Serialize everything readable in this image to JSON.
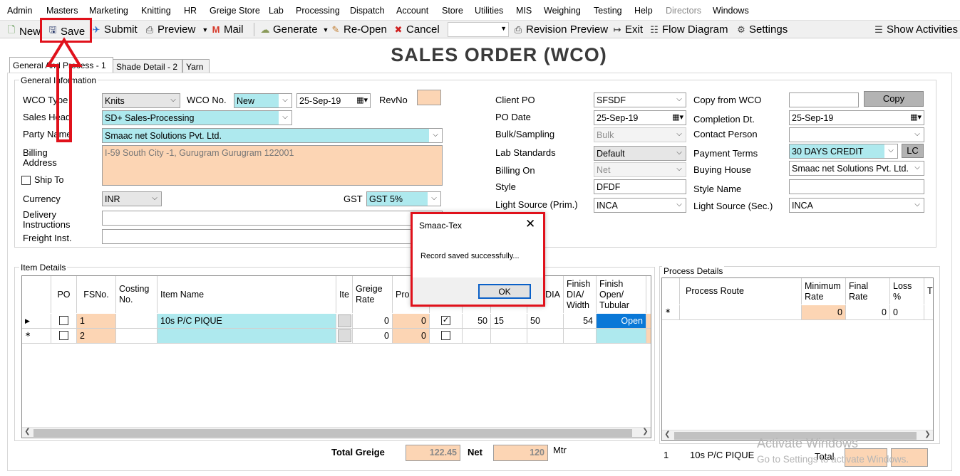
{
  "menu": [
    "Admin",
    "Masters",
    "Marketing",
    "Knitting",
    "HR",
    "Greige Store",
    "Lab",
    "Processing",
    "Dispatch",
    "Account",
    "Store",
    "Utilities",
    "MIS",
    "Weighing",
    "Testing",
    "Help",
    "Directors",
    "Windows"
  ],
  "toolbar": {
    "new": "New",
    "save": "Save",
    "submit": "Submit",
    "preview": "Preview",
    "mail": "Mail",
    "generate": "Generate",
    "reopen": "Re-Open",
    "cancel": "Cancel",
    "revision_preview": "Revision Preview",
    "exit": "Exit",
    "flow_diagram": "Flow Diagram",
    "settings": "Settings",
    "show_activities": "Show Activities"
  },
  "page_title": "SALES ORDER (WCO)",
  "tabs": [
    "General And Process - 1",
    "Shade Detail - 2",
    "Yarn"
  ],
  "general": {
    "group_title": "General Information",
    "wco_type_label": "WCO Type",
    "wco_type": "Knits",
    "wco_no_label": "WCO No.",
    "wco_no": "New",
    "wco_date": "25-Sep-19",
    "revno_label": "RevNo",
    "sales_head_label": "Sales Head",
    "sales_head": "SD+ Sales-Processing",
    "party_name_label": "Party Name",
    "party_name": "Smaac net Solutions Pvt. Ltd.",
    "billing_address_label_1": "Billing",
    "billing_address_label_2": "Address",
    "billing_address": "I-59 South City -1, Gurugram Gurugram 122001",
    "ship_to_label": "Ship To",
    "currency_label": "Currency",
    "currency": "INR",
    "gst_label": "GST",
    "gst": "GST 5%",
    "delivery_label_1": "Delivery",
    "delivery_label_2": "Instructions",
    "freight_label": "Freight Inst.",
    "client_po_label": "Client PO",
    "client_po": "SFSDF",
    "po_date_label": "PO Date",
    "po_date": "25-Sep-19",
    "bulk_label": "Bulk/Sampling",
    "bulk": "Bulk",
    "lab_std_label": "Lab Standards",
    "lab_std": "Default",
    "billing_on_label": "Billing On",
    "billing_on": "Net",
    "style_label": "Style",
    "style": "DFDF",
    "light_prim_label": "Light Source (Prim.)",
    "light_prim": "INCA",
    "copy_from_label": "Copy from WCO",
    "copy_btn": "Copy",
    "completion_label": "Completion Dt.",
    "completion": "25-Sep-19",
    "contact_label": "Contact Person",
    "payment_label": "Payment Terms",
    "payment": "30 DAYS CREDIT",
    "lc_btn": "LC",
    "buying_house_label": "Buying House",
    "buying_house": "Smaac net Solutions Pvt. Ltd.",
    "style_name_label": "Style Name",
    "light_sec_label": "Light Source (Sec.)",
    "light_sec": "INCA"
  },
  "items": {
    "group_title": "Item Details",
    "headers": {
      "po": "PO",
      "fsno": "FSNo.",
      "costing": "Costing No.",
      "item_name": "Item Name",
      "ite": "Ite",
      "greige_rate": "Greige Rate",
      "pro": "Pro Ra",
      "dia": "DIA",
      "finish_dia": "Finish DIA/ Width",
      "finish_open": "Finish Open/ Tubular"
    },
    "rows": [
      {
        "fsno": "1",
        "item": "10s P/C PIQUE",
        "greige": "0",
        "pro": "0",
        "v1": "50",
        "v2": "15",
        "v3": "50",
        "finish": "54",
        "open": "Open"
      },
      {
        "fsno": "2",
        "item": "",
        "greige": "0",
        "pro": "0",
        "v1": "",
        "v2": "",
        "v3": "",
        "finish": "",
        "open": ""
      }
    ]
  },
  "process": {
    "group_title": "Process Details",
    "headers": {
      "route": "Process Route",
      "min_rate": "Minimum Rate",
      "final_rate": "Final Rate",
      "loss": "Loss %",
      "t": "T"
    },
    "row": {
      "min": "0",
      "final": "0",
      "loss": "0"
    },
    "footer_no": "1",
    "footer_item": "10s P/C PIQUE",
    "total_label": "Total"
  },
  "totals": {
    "greige_label": "Total Greige",
    "greige": "122.45",
    "net_label": "Net",
    "net": "120",
    "unit": "Mtr"
  },
  "dialog": {
    "title": "Smaac-Tex",
    "message": "Record saved successfully...",
    "ok": "OK"
  },
  "watermark": {
    "line1": "Activate Windows",
    "line2": "Go to Settings to activate Windows."
  }
}
